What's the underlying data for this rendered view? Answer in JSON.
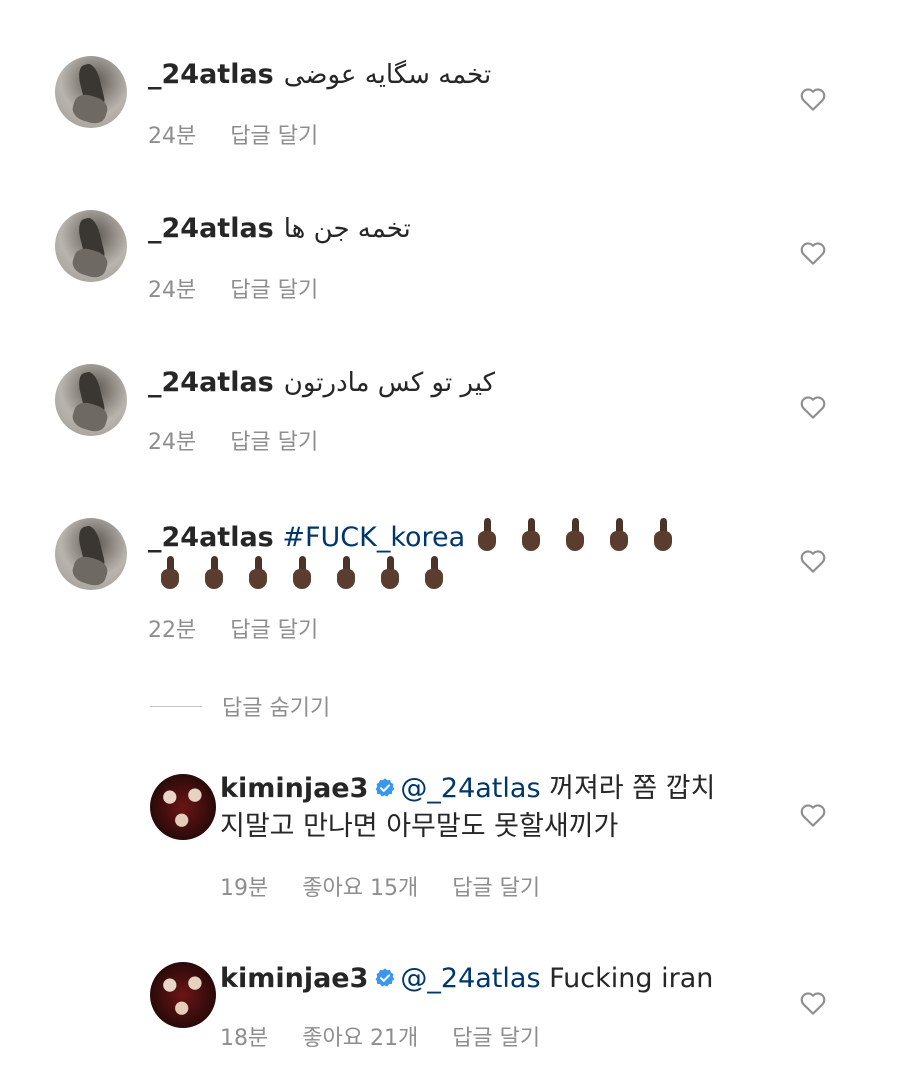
{
  "comments": [
    {
      "username": "_24atlas",
      "text": "تخمه سگایه عوضی",
      "time": "24분",
      "reply": "답글 달기"
    },
    {
      "username": "_24atlas",
      "text": "تخمه جن ها",
      "time": "24분",
      "reply": "답글 달기"
    },
    {
      "username": "_24atlas",
      "text": "کیر تو کس مادرتون",
      "time": "24분",
      "reply": "답글 달기"
    },
    {
      "username": "_24atlas",
      "hashtag": "#FUCK_korea",
      "emoji_first_line": 5,
      "emoji_second_line": 7,
      "emoji_name": "middle-finger-dark-skin",
      "time": "22분",
      "reply": "답글 달기"
    }
  ],
  "hide_replies": "답글 숨기기",
  "replies": [
    {
      "username": "kiminjae3",
      "verified": true,
      "mention": "@_24atlas",
      "text_line1": "꺼져라 쫌 깝치",
      "text_line2": "지말고 만나면 아무말도 못할새끼가",
      "time": "19분",
      "likes": "좋아요 15개",
      "reply": "답글 달기"
    },
    {
      "username": "kiminjae3",
      "verified": true,
      "mention": "@_24atlas",
      "text_line1": "Fucking iran",
      "time": "18분",
      "likes": "좋아요 21개",
      "reply": "답글 달기"
    }
  ],
  "colors": {
    "text": "#262626",
    "meta": "#8e8e8e",
    "link": "#00376b",
    "verified": "#3897f0"
  }
}
